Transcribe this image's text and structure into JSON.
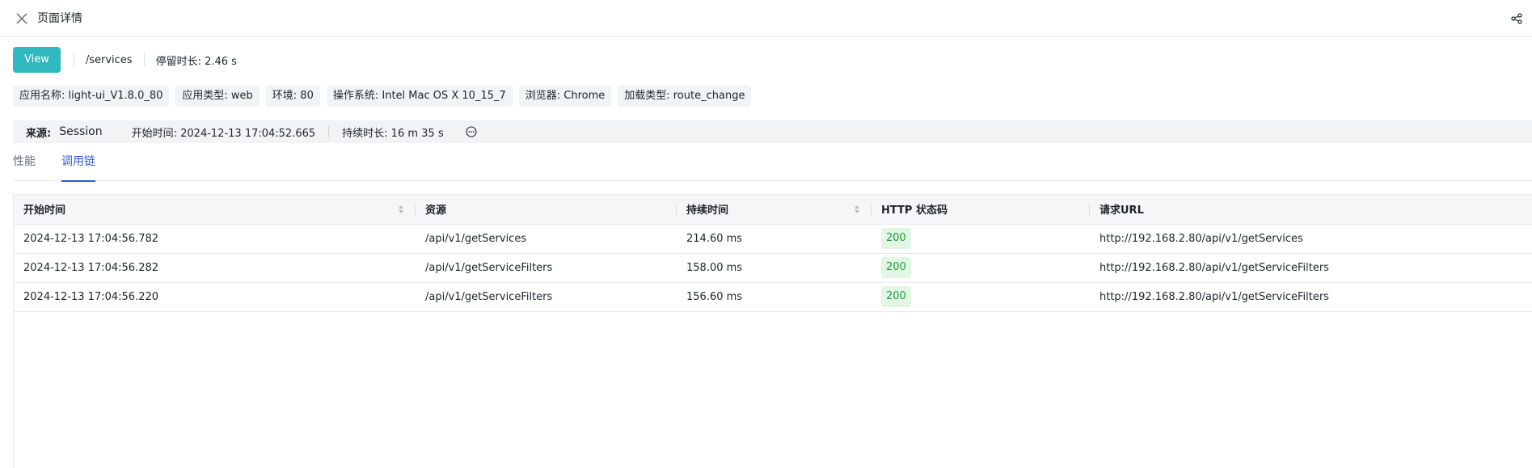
{
  "header": {
    "title": "页面详情",
    "close_icon": "close-icon",
    "share_icon": "share-icon"
  },
  "summary": {
    "view_label": "View",
    "path": "/services",
    "stay": "停留时长: 2.46 s"
  },
  "tags": [
    "应用名称: light-ui_V1.8.0_80",
    "应用类型: web",
    "环境: 80",
    "操作系统: Intel Mac OS X 10_15_7",
    "浏览器: Chrome",
    "加载类型: route_change"
  ],
  "source": {
    "label": "来源:",
    "value": "Session",
    "start": "开始时间: 2024-12-13 17:04:52.665",
    "duration": "持续时长: 16 m 35 s",
    "more_icon": "more-circle-icon"
  },
  "tabs": [
    {
      "label": "性能",
      "active": false
    },
    {
      "label": "调用链",
      "active": true
    }
  ],
  "table": {
    "columns": [
      "开始时间",
      "资源",
      "持续时间",
      "HTTP 状态码",
      "请求URL"
    ],
    "rows": [
      {
        "start": "2024-12-13 17:04:56.782",
        "resource": "/api/v1/getServices",
        "duration": "214.60 ms",
        "status": "200",
        "url": "http://192.168.2.80/api/v1/getServices"
      },
      {
        "start": "2024-12-13 17:04:56.282",
        "resource": "/api/v1/getServiceFilters",
        "duration": "158.00 ms",
        "status": "200",
        "url": "http://192.168.2.80/api/v1/getServiceFilters"
      },
      {
        "start": "2024-12-13 17:04:56.220",
        "resource": "/api/v1/getServiceFilters",
        "duration": "156.60 ms",
        "status": "200",
        "url": "http://192.168.2.80/api/v1/getServiceFilters"
      }
    ]
  },
  "colors": {
    "accent": "#2fb8bf",
    "tab_active": "#2f5bd8",
    "status_ok_bg": "#e3f6e6",
    "status_ok_text": "#1e9e3a"
  }
}
